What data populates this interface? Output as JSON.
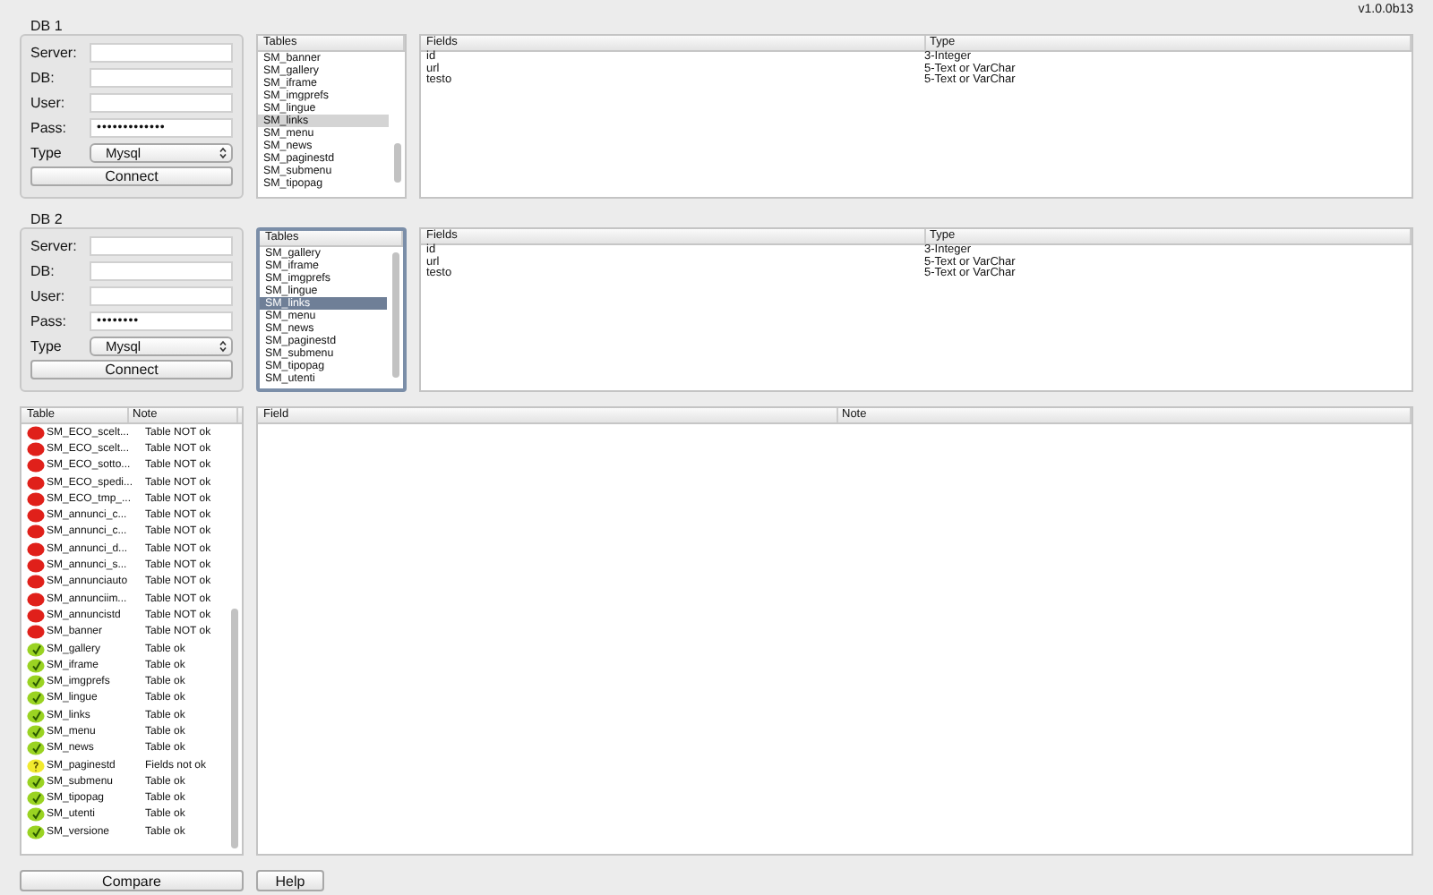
{
  "version": "v1.0.0b13",
  "databases": [
    {
      "label": "DB 1",
      "form": {
        "fields": [
          {
            "label": "Server:",
            "kind": "text"
          },
          {
            "label": "DB:",
            "kind": "text"
          },
          {
            "label": "User:",
            "kind": "text"
          },
          {
            "label": "Pass:",
            "kind": "password",
            "value": "•••••••••••••"
          },
          {
            "label": "Type",
            "kind": "select",
            "value": "Mysql"
          }
        ],
        "button": "Connect"
      },
      "tables": {
        "header": "Tables",
        "focused": false,
        "items": [
          {
            "name": "SM_banner",
            "selected": false
          },
          {
            "name": "SM_gallery",
            "selected": false
          },
          {
            "name": "SM_iframe",
            "selected": false
          },
          {
            "name": "SM_imgprefs",
            "selected": false
          },
          {
            "name": "SM_lingue",
            "selected": false
          },
          {
            "name": "SM_links",
            "selected": true
          },
          {
            "name": "SM_menu",
            "selected": false
          },
          {
            "name": "SM_news",
            "selected": false
          },
          {
            "name": "SM_paginestd",
            "selected": false
          },
          {
            "name": "SM_submenu",
            "selected": false
          },
          {
            "name": "SM_tipopag",
            "selected": false
          }
        ]
      },
      "fields": {
        "columns": [
          "Fields",
          "Type"
        ],
        "rows": [
          [
            "id",
            "3-Integer"
          ],
          [
            "url",
            "5-Text or VarChar"
          ],
          [
            "testo",
            "5-Text or VarChar"
          ]
        ]
      }
    },
    {
      "label": "DB 2",
      "form": {
        "fields": [
          {
            "label": "Server:",
            "kind": "text"
          },
          {
            "label": "DB:",
            "kind": "text"
          },
          {
            "label": "User:",
            "kind": "text"
          },
          {
            "label": "Pass:",
            "kind": "password",
            "value": "••••••••"
          },
          {
            "label": "Type",
            "kind": "select",
            "value": "Mysql"
          }
        ],
        "button": "Connect"
      },
      "tables": {
        "header": "Tables",
        "focused": true,
        "items": [
          {
            "name": "SM_gallery",
            "selected": false
          },
          {
            "name": "SM_iframe",
            "selected": false
          },
          {
            "name": "SM_imgprefs",
            "selected": false
          },
          {
            "name": "SM_lingue",
            "selected": false
          },
          {
            "name": "SM_links",
            "selected": true
          },
          {
            "name": "SM_menu",
            "selected": false
          },
          {
            "name": "SM_news",
            "selected": false
          },
          {
            "name": "SM_paginestd",
            "selected": false
          },
          {
            "name": "SM_submenu",
            "selected": false
          },
          {
            "name": "SM_tipopag",
            "selected": false
          },
          {
            "name": "SM_utenti",
            "selected": false
          }
        ]
      },
      "fields": {
        "columns": [
          "Fields",
          "Type"
        ],
        "rows": [
          [
            "id",
            "3-Integer"
          ],
          [
            "url",
            "5-Text or VarChar"
          ],
          [
            "testo",
            "5-Text or VarChar"
          ]
        ]
      }
    }
  ],
  "comparison": {
    "columns": [
      "Table",
      "Note"
    ],
    "rows": [
      {
        "table": "SM_ECO_scelt...",
        "note": "Table NOT ok",
        "kind": "error"
      },
      {
        "table": "SM_ECO_scelt...",
        "note": "Table NOT ok",
        "kind": "error"
      },
      {
        "table": "SM_ECO_sotto...",
        "note": "Table NOT ok",
        "kind": "error"
      },
      {
        "table": "SM_ECO_spedi...",
        "note": "Table NOT ok",
        "kind": "error"
      },
      {
        "table": "SM_ECO_tmp_...",
        "note": "Table NOT ok",
        "kind": "error"
      },
      {
        "table": "SM_annunci_c...",
        "note": "Table NOT ok",
        "kind": "error"
      },
      {
        "table": "SM_annunci_c...",
        "note": "Table NOT ok",
        "kind": "error"
      },
      {
        "table": "SM_annunci_d...",
        "note": "Table NOT ok",
        "kind": "error"
      },
      {
        "table": "SM_annunci_s...",
        "note": "Table NOT ok",
        "kind": "error"
      },
      {
        "table": "SM_annunciauto",
        "note": "Table NOT ok",
        "kind": "error"
      },
      {
        "table": "SM_annunciim...",
        "note": "Table NOT ok",
        "kind": "error"
      },
      {
        "table": "SM_annuncistd",
        "note": "Table NOT ok",
        "kind": "error"
      },
      {
        "table": "SM_banner",
        "note": "Table NOT ok",
        "kind": "error"
      },
      {
        "table": "SM_gallery",
        "note": "Table ok",
        "kind": "ok"
      },
      {
        "table": "SM_iframe",
        "note": "Table ok",
        "kind": "ok"
      },
      {
        "table": "SM_imgprefs",
        "note": "Table ok",
        "kind": "ok"
      },
      {
        "table": "SM_lingue",
        "note": "Table ok",
        "kind": "ok"
      },
      {
        "table": "SM_links",
        "note": "Table ok",
        "kind": "ok"
      },
      {
        "table": "SM_menu",
        "note": "Table ok",
        "kind": "ok"
      },
      {
        "table": "SM_news",
        "note": "Table ok",
        "kind": "ok"
      },
      {
        "table": "SM_paginestd",
        "note": "Fields not ok",
        "kind": "warning"
      },
      {
        "table": "SM_submenu",
        "note": "Table ok",
        "kind": "ok"
      },
      {
        "table": "SM_tipopag",
        "note": "Table ok",
        "kind": "ok"
      },
      {
        "table": "SM_utenti",
        "note": "Table ok",
        "kind": "ok"
      },
      {
        "table": "SM_versione",
        "note": "Table ok",
        "kind": "ok"
      }
    ]
  },
  "details": {
    "columns": [
      "Field",
      "Note"
    ]
  },
  "buttons": [
    "Compare",
    "Help"
  ]
}
